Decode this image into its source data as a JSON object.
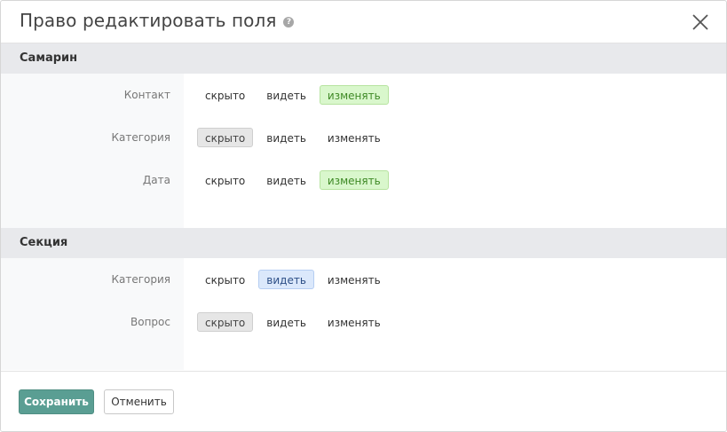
{
  "dialog": {
    "title": "Право редактировать поля",
    "help_icon": "?",
    "close_icon": "close-icon"
  },
  "sections": [
    {
      "title": "Самарин",
      "rows": [
        {
          "label": "Контакт",
          "selected": "edit"
        },
        {
          "label": "Категория",
          "selected": "hidden"
        },
        {
          "label": "Дата",
          "selected": "edit"
        }
      ]
    },
    {
      "title": "Секция",
      "rows": [
        {
          "label": "Категория",
          "selected": "view"
        },
        {
          "label": "Вопрос",
          "selected": "hidden"
        }
      ]
    }
  ],
  "options": {
    "hidden": "скрыто",
    "view": "видеть",
    "edit": "изменять"
  },
  "footer": {
    "save_label": "Сохранить",
    "cancel_label": "Отменить"
  },
  "colors": {
    "save_button": "#5a9e93",
    "edit_selected": "#d9f7cc",
    "view_selected": "#dbe8fb",
    "hidden_selected": "#e6e6e6",
    "section_header": "#e8e9ec"
  }
}
